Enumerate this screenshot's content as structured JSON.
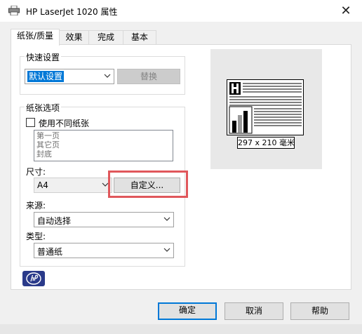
{
  "window": {
    "title": "HP LaserJet 1020 属性",
    "close_label": "✕"
  },
  "tabs": [
    {
      "label": "纸张/质量"
    },
    {
      "label": "效果"
    },
    {
      "label": "完成"
    },
    {
      "label": "基本"
    }
  ],
  "quick_settings": {
    "group_label": "快速设置",
    "selected": "默认设置",
    "replace_label": "替换"
  },
  "paper_options": {
    "group_label": "纸张选项",
    "use_different_paper_label": "使用不同纸张",
    "list_items": [
      "第一页",
      "其它页",
      "封底"
    ],
    "size_label": "尺寸:",
    "size_value": "A4",
    "custom_button": "自定义...",
    "source_label": "来源:",
    "source_value": "自动选择",
    "type_label": "类型:",
    "type_value": "普通纸"
  },
  "preview": {
    "size_text": "297 x 210 毫米"
  },
  "buttons": {
    "ok": "确定",
    "cancel": "取消",
    "help": "帮助"
  },
  "colors": {
    "accent": "#0078d7",
    "highlight": "#e0575b",
    "hp_blue": "#2a3a8a"
  },
  "icons": [
    "printer-icon",
    "close-icon",
    "chevron-down-icon",
    "hp-logo"
  ]
}
